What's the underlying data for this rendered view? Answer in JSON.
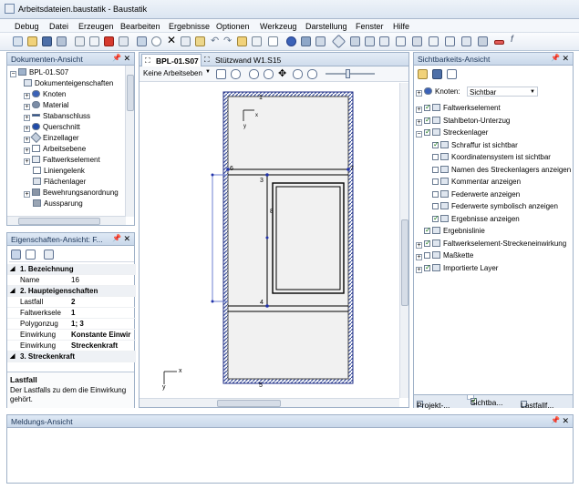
{
  "window": {
    "title": "Arbeitsdateien.baustatik - Baustatik"
  },
  "menu": [
    "Debug",
    "Datei",
    "Erzeugen",
    "Bearbeiten",
    "Ergebnisse",
    "Optionen",
    "Werkzeug",
    "Darstellung",
    "Fenster",
    "Hilfe"
  ],
  "doc_panel": {
    "title": "Dokumenten-Ansicht",
    "root": "BPL-01.S07",
    "items": [
      "Dokumenteigenschaften",
      "Knoten",
      "Material",
      "Stabanschluss",
      "Querschnitt",
      "Einzellager",
      "Arbeitsebene",
      "Faltwerkselement",
      "Liniengelenk",
      "Flächenlager",
      "Bewehrungsanordnung",
      "Aussparung"
    ]
  },
  "props_panel": {
    "title": "Eigenschaften-Ansicht: F...",
    "rows": [
      {
        "k": "1. Bezeichnung",
        "v": "",
        "cat": true
      },
      {
        "k": "Name",
        "v": "16"
      },
      {
        "k": "2. Haupteigenschaften",
        "v": "",
        "cat": true
      },
      {
        "k": "Lastfall",
        "v": "2"
      },
      {
        "k": "Faltwerksele",
        "v": "1"
      },
      {
        "k": "Polygonzug",
        "v": "1; 3"
      },
      {
        "k": "Einwirkung",
        "v": "Konstante Einwir"
      },
      {
        "k": "Einwirkung",
        "v": "Streckenkraft"
      },
      {
        "k": "3. Streckenkraft",
        "v": "",
        "cat": true
      }
    ],
    "desc_title": "Lastfall",
    "desc_text": "Der Lastfalls zu dem die Einwirkung gehört."
  },
  "editor": {
    "tabs": [
      "BPL-01.S07",
      "Stützwand W1.S15"
    ],
    "level_select": "Keine Arbeitseben",
    "node_labels": [
      "1",
      "3",
      "4",
      "5",
      "6",
      "7",
      "8"
    ],
    "axis_x": "x",
    "axis_y": "y"
  },
  "vis_panel": {
    "title": "Sichtbarkeits-Ansicht",
    "knoten_label": "Knoten:",
    "knoten_value": "Sichtbar",
    "items": [
      {
        "label": "Faltwerkselement",
        "indent": 0,
        "checked": true,
        "expander": "+"
      },
      {
        "label": "Stahlbeton-Unterzug",
        "indent": 0,
        "checked": true,
        "expander": "+"
      },
      {
        "label": "Streckenlager",
        "indent": 0,
        "checked": true,
        "expander": "−"
      },
      {
        "label": "Schraffur ist sichtbar",
        "indent": 1,
        "checked": true,
        "expander": ""
      },
      {
        "label": "Koordinatensystem ist sichtbar",
        "indent": 1,
        "checked": false,
        "expander": ""
      },
      {
        "label": "Namen des Streckenlagers anzeigen",
        "indent": 1,
        "checked": false,
        "expander": ""
      },
      {
        "label": "Kommentar anzeigen",
        "indent": 1,
        "checked": false,
        "expander": ""
      },
      {
        "label": "Federwerte anzeigen",
        "indent": 1,
        "checked": false,
        "expander": ""
      },
      {
        "label": "Federwerte symbolisch anzeigen",
        "indent": 1,
        "checked": false,
        "expander": ""
      },
      {
        "label": "Ergebnisse anzeigen",
        "indent": 1,
        "checked": true,
        "expander": ""
      },
      {
        "label": "Ergebnislinie",
        "indent": 0,
        "checked": true,
        "expander": ""
      },
      {
        "label": "Faltwerkselement-Streckeneinwirkung",
        "indent": 0,
        "checked": true,
        "expander": "+"
      },
      {
        "label": "Maßkette",
        "indent": 0,
        "checked": false,
        "expander": "+"
      },
      {
        "label": "Importierte Layer",
        "indent": 0,
        "checked": true,
        "expander": "+"
      }
    ],
    "bottom_tabs": [
      "Projekt-...",
      "Sichtba...",
      "Lastfallf..."
    ]
  },
  "messages_panel": {
    "title": "Meldungs-Ansicht"
  }
}
